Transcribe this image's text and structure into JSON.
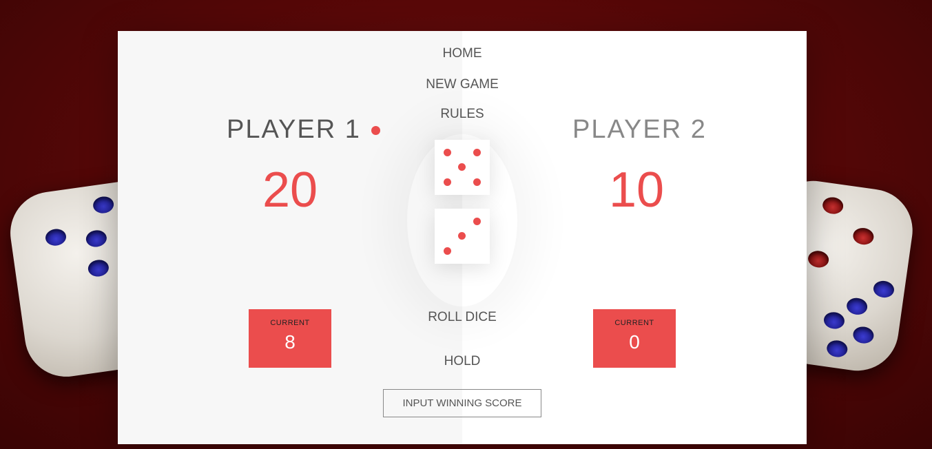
{
  "menu": {
    "home": "HOME",
    "new_game": "NEW GAME",
    "rules": "RULES",
    "roll_dice": "ROLL DICE",
    "hold": "HOLD"
  },
  "players": [
    {
      "name": "PLAYER 1",
      "score": "20",
      "current_label": "CURRENT",
      "current_score": "8",
      "active": true
    },
    {
      "name": "PLAYER 2",
      "score": "10",
      "current_label": "CURRENT",
      "current_score": "0",
      "active": false
    }
  ],
  "dice": [
    5,
    3
  ],
  "winning_score_input": {
    "placeholder": "INPUT WINNING SCORE",
    "value": ""
  },
  "colors": {
    "accent": "#eb4d4d",
    "text": "#555555",
    "panel_active": "#f7f7f7"
  }
}
